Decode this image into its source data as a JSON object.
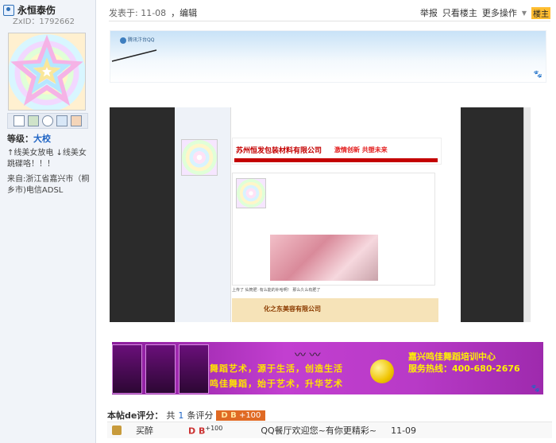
{
  "user": {
    "name": "永恒泰伤",
    "id_label": "ZxID：1792662",
    "level_label": "等级：",
    "level": "大校",
    "signature": "↑线美女放电 ↓线美女跳碟咯！！！",
    "from": "来自:浙江省嘉兴市（桐乡市)电信ADSL"
  },
  "post": {
    "time": "发表于: 11-08",
    "edit": "，编辑",
    "actions": [
      "举报",
      "只看楼主",
      "更多操作"
    ],
    "louzhu": "楼主"
  },
  "banner_top": {
    "logo": "腾讯汴台QQ"
  },
  "screenshot": {
    "company": "苏州恒发包装材料有限公司",
    "slogan": "激情创新  共塑未来",
    "caption": "上传了 仙筒肥 ·有么能的补哈啊！ 那么久么有肥了",
    "yellow_ad": "化之东美容有限公司"
  },
  "purple_banner": {
    "line1": "舞蹈艺术，源于生活，创造生活",
    "line2": "鸣佳舞蹈，始于艺术，升华艺术",
    "title": "嘉兴鸣佳舞蹈培训中心",
    "phone": "服务热线：400-680-2676"
  },
  "rating": {
    "label": "本帖de评分：",
    "count_prefix": "共",
    "count": "1",
    "count_suffix": "条评分",
    "badge_db": "D B",
    "badge_val": "+100",
    "rows": [
      {
        "rater": "买醉",
        "db": "D B",
        "val": "+100",
        "reason": "QQ餐厅欢迎您~有你更精彩~",
        "time": "11-09"
      }
    ]
  },
  "colors": {
    "accent_orange": "#e06a24",
    "link_blue": "#1f64c4",
    "sidebar_bg": "#f1f4f9"
  }
}
